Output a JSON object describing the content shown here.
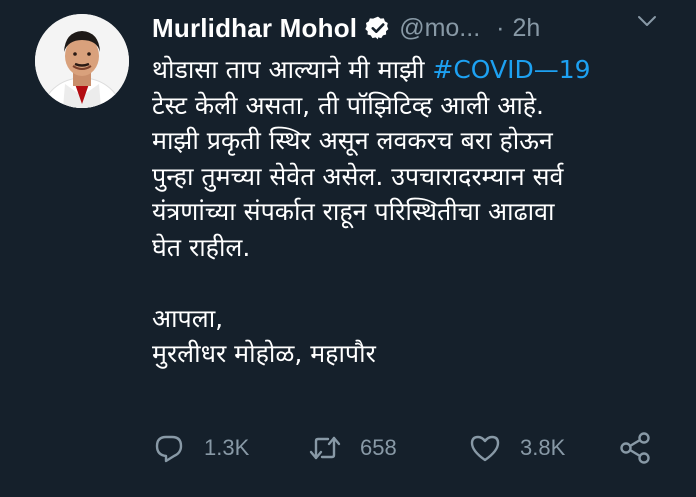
{
  "tweet": {
    "author_name": "Murlidhar Mohol",
    "handle": "@mo...",
    "separator": "·",
    "time": "2h",
    "verified_icon": "verified-badge-icon",
    "lines": [
      "थोडासा ताप आल्याने मी माझी ",
      "टेस्ट केली असता, ती पॉझिटिव्ह आली आहे.",
      "माझी प्रकृती स्थिर असून लवकरच बरा होऊन",
      "पुन्हा तुमच्या सेवेत असेल. उपचारादरम्यान सर्व",
      "यंत्रणांच्या संपर्कात राहून परिस्थितीचा आढावा",
      "घेत राहील.",
      "आपला,",
      "मुरलीधर मोहोळ, महापौर"
    ],
    "hashtag": "#COVID—19"
  },
  "actions": {
    "reply_count": "1.3K",
    "retweet_count": "658",
    "like_count": "3.8K"
  },
  "colors": {
    "background": "#15202b",
    "text": "#ffffff",
    "muted": "#8899a6",
    "accent": "#1da1f2"
  }
}
